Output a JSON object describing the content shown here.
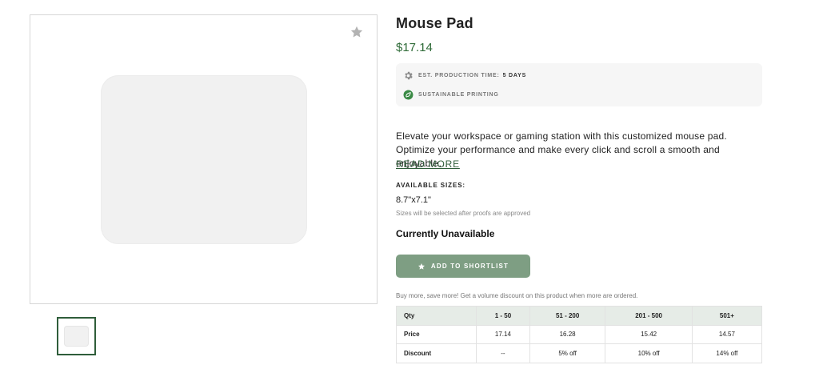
{
  "gallery": {
    "favorite_icon": "star-icon"
  },
  "product": {
    "title": "Mouse Pad",
    "price": "$17.14",
    "production": {
      "label": "EST. PRODUCTION TIME:",
      "value": "5 DAYS",
      "icon": "gear-icon"
    },
    "sustainable": {
      "label": "SUSTAINABLE PRINTING",
      "icon": "leaf-icon"
    },
    "description": "Elevate your workspace or gaming station with this customized mouse pad. Optimize your performance and make every click and scroll a smooth and enjoyable…",
    "read_more": "READ MORE",
    "sizes": {
      "label": "AVAILABLE SIZES:",
      "value": "8.7\"x7.1\"",
      "note": "Sizes will be selected after proofs are approved"
    },
    "availability": "Currently Unavailable",
    "shortlist_button": "ADD TO SHORTLIST",
    "bulk_note": "Buy more, save more! Get a volume discount on this product when more are ordered.",
    "accent_color": "#2f6b38",
    "button_color": "#7e9e83"
  },
  "volume_table": {
    "headers": [
      "Qty",
      "1 - 50",
      "51 - 200",
      "201 - 500",
      "501+"
    ],
    "rows": [
      [
        "Price",
        "17.14",
        "16.28",
        "15.42",
        "14.57"
      ],
      [
        "Discount",
        "--",
        "5% off",
        "10% off",
        "14% off"
      ]
    ]
  }
}
